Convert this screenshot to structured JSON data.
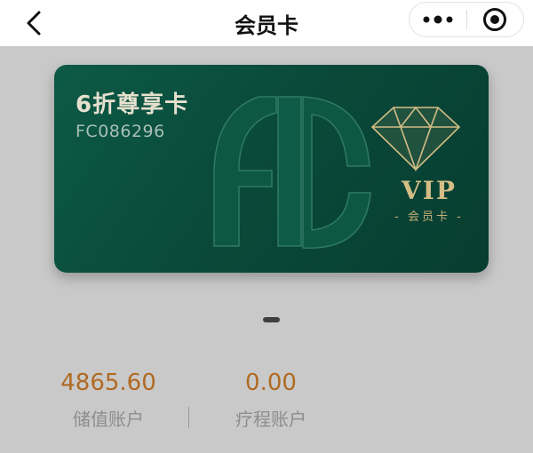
{
  "nav": {
    "title": "会员卡",
    "back_icon": "chevron-left-icon",
    "more_icon": "more-dots-icon",
    "close_icon": "target-circle-icon"
  },
  "card": {
    "name": "6折尊享卡",
    "number": "FC086296",
    "logo_letters": "FC",
    "vip_label": "VIP",
    "vip_sublabel": "- 会员卡 -",
    "colors": {
      "background": "#0a4a3a",
      "gold": "#d4bd86"
    }
  },
  "carousel": {
    "active_index": 1,
    "total": 1
  },
  "accounts": [
    {
      "value": "4865.60",
      "label": "储值账户"
    },
    {
      "value": "0.00",
      "label": "疗程账户"
    }
  ],
  "colors": {
    "value_text": "#b06a22",
    "label_text": "#8d8d8d",
    "page_background": "#c9c9c9"
  }
}
